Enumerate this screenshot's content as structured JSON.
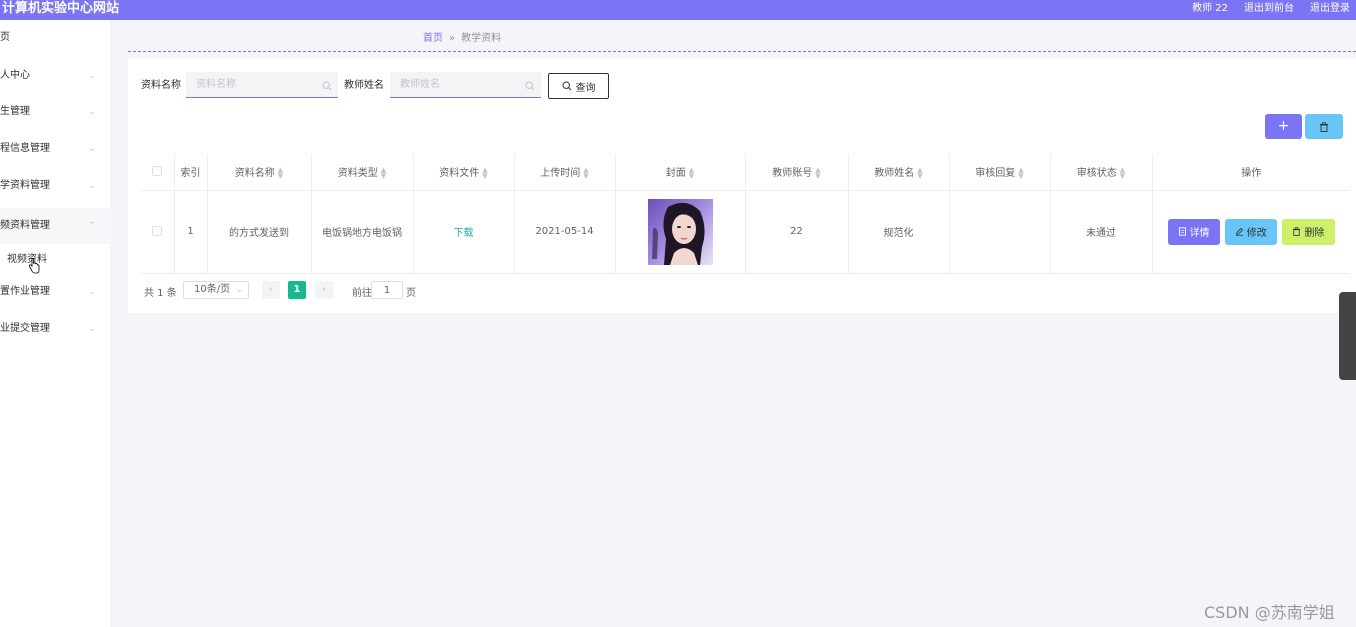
{
  "header": {
    "site_title": "计算机实验中心网站",
    "user_label": "教师 22",
    "back_to_front": "退出到前台",
    "logout": "退出登录"
  },
  "sidebar": {
    "items": [
      {
        "label": "首页"
      },
      {
        "label": "个人中心"
      },
      {
        "label": "学生管理"
      },
      {
        "label": "课程信息管理"
      },
      {
        "label": "教学资料管理"
      },
      {
        "label": "视频资料管理"
      },
      {
        "label": "布置作业管理"
      },
      {
        "label": "作业提交管理"
      }
    ],
    "sub_item": "视频资料"
  },
  "breadcrumb": {
    "home": "首页",
    "separator": "»",
    "current": "教学资料"
  },
  "search": {
    "name_label": "资料名称",
    "name_placeholder": "资料名称",
    "teacher_label": "教师姓名",
    "teacher_placeholder": "教师姓名",
    "query_button": "查询"
  },
  "actions": {
    "add_symbol": "+"
  },
  "table": {
    "columns": [
      "索引",
      "资料名称",
      "资料类型",
      "资料文件",
      "上传时间",
      "封面",
      "教师账号",
      "教师姓名",
      "审核回复",
      "审核状态",
      "操作"
    ],
    "rows": [
      {
        "index": "1",
        "name": "的方式发送到",
        "type": "电饭锅地方电饭锅",
        "file": "下载",
        "upload_time": "2021-05-14",
        "teacher_account": "22",
        "teacher_name": "规范化",
        "review_reply": "",
        "review_status": "未通过"
      }
    ],
    "row_buttons": {
      "detail": "详情",
      "edit": "修改",
      "delete": "删除"
    }
  },
  "pagination": {
    "total": "共 1 条",
    "page_size": "10条/页",
    "current_page": "1",
    "goto_label": "前往",
    "goto_value": "1",
    "page_unit": "页"
  },
  "watermark": "CSDN @苏南学姐",
  "colors": {
    "primary": "#7b74f5",
    "info": "#67c6f5",
    "danger_light": "#cdf06b",
    "pager_active": "#17b890"
  }
}
